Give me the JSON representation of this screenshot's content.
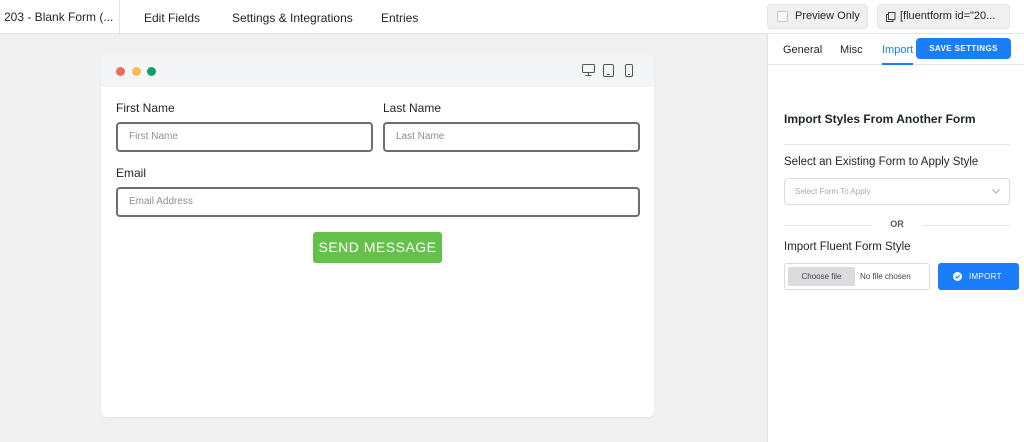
{
  "topbar": {
    "form_title": "203 - Blank Form (...",
    "nav": [
      "Edit Fields",
      "Settings & Integrations",
      "Entries"
    ],
    "preview_label": "Preview Only",
    "shortcode": "[fluentform id=\"20..."
  },
  "canvas": {
    "dot_colors": [
      "#ee6a5f",
      "#f5bd4f",
      "#61c554"
    ],
    "first_name_label": "First Name",
    "first_name_placeholder": "First Name",
    "last_name_label": "Last Name",
    "last_name_placeholder": "Last Name",
    "email_label": "Email",
    "email_placeholder": "Email Address",
    "submit_label": "SEND MESSAGE"
  },
  "panel": {
    "tabs": [
      "General",
      "Misc",
      "Import"
    ],
    "active_tab": "Import",
    "save_label": "SAVE SETTINGS",
    "title": "Import Styles From Another Form",
    "select_label": "Select an Existing Form to Apply Style",
    "select_placeholder": "Select Form To Apply",
    "or_text": "OR",
    "import_label": "Import Fluent Form Style",
    "choose_file": "Choose file",
    "no_file": "No file chosen",
    "import_button": "IMPORT"
  },
  "colors": {
    "accent": "#1a7efb",
    "submit": "#65c14b"
  }
}
